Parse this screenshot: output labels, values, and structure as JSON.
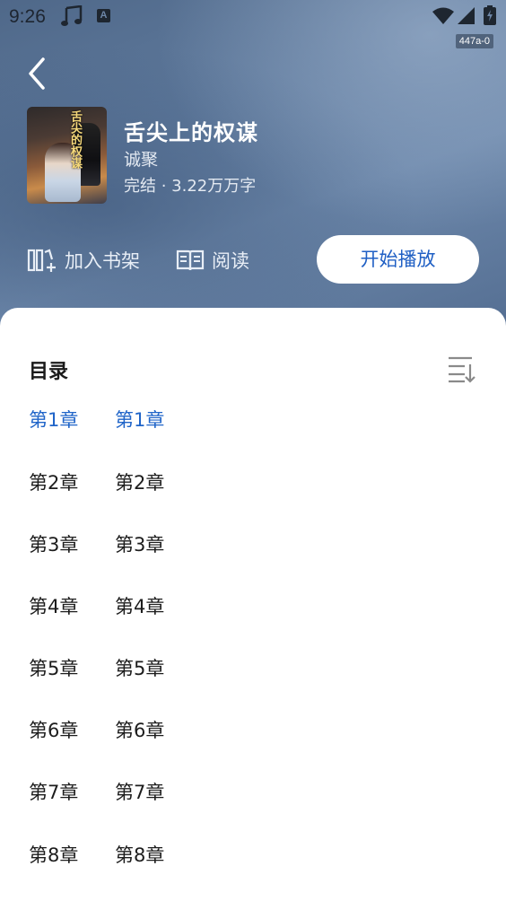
{
  "status_bar": {
    "time": "9:26",
    "a_glyph": "A",
    "version": "447a-0"
  },
  "book": {
    "title": "舌尖上的权谋",
    "author": "诚聚",
    "meta": "完结 · 3.22万万字",
    "cover_text": "舌尖的权谋"
  },
  "actions": {
    "add_shelf": "加入书架",
    "read": "阅读",
    "play": "开始播放"
  },
  "toc": {
    "header": "目录",
    "chapters": [
      {
        "num": "第1章",
        "name": "第1章",
        "active": true
      },
      {
        "num": "第2章",
        "name": "第2章",
        "active": false
      },
      {
        "num": "第3章",
        "name": "第3章",
        "active": false
      },
      {
        "num": "第4章",
        "name": "第4章",
        "active": false
      },
      {
        "num": "第5章",
        "name": "第5章",
        "active": false
      },
      {
        "num": "第6章",
        "name": "第6章",
        "active": false
      },
      {
        "num": "第7章",
        "name": "第7章",
        "active": false
      },
      {
        "num": "第8章",
        "name": "第8章",
        "active": false
      }
    ]
  },
  "colors": {
    "accent": "#1f64c8",
    "hero": "#5f7a9d"
  },
  "icons": {
    "back": "chevron-left-icon",
    "shelf": "add-to-shelf-icon",
    "read": "open-book-icon",
    "sort": "sort-list-icon"
  }
}
